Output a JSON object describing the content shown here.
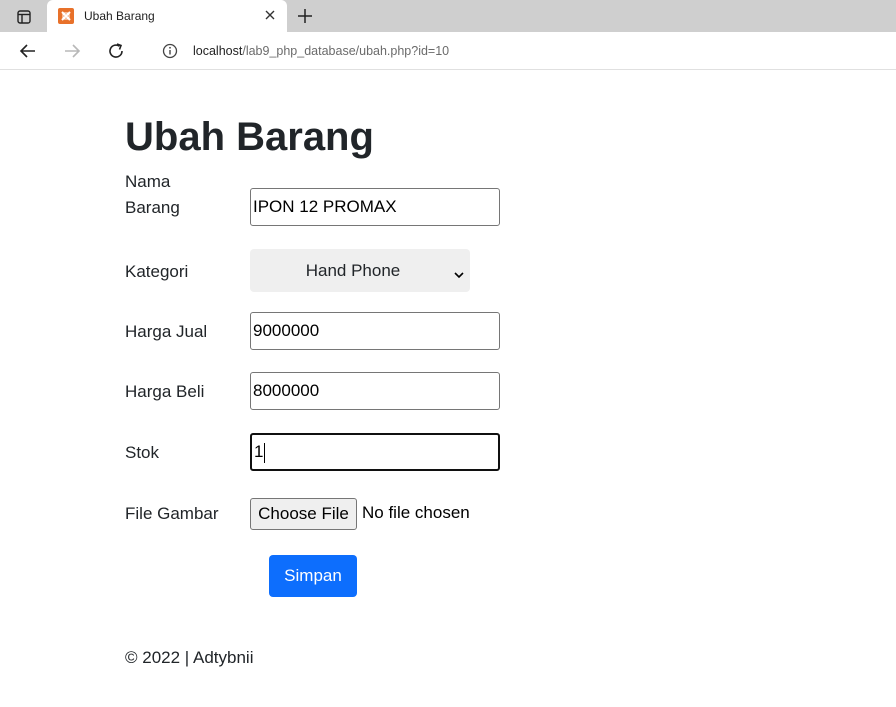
{
  "browser": {
    "tab_title": "Ubah Barang",
    "url_host": "localhost",
    "url_path": "/lab9_php_database/ubah.php?id=10",
    "icons": {
      "tab_actions": "sidebar-panel-icon",
      "favicon": "xampp-icon",
      "close": "close-icon",
      "new_tab": "plus-icon",
      "back": "arrow-left-icon",
      "forward": "arrow-right-icon",
      "refresh": "refresh-icon",
      "info": "info-icon"
    }
  },
  "page": {
    "title": "Ubah Barang"
  },
  "form": {
    "nama_label": "Nama Barang",
    "nama_value": "IPON 12 PROMAX",
    "kategori_label": "Kategori",
    "kategori_value": "Hand Phone",
    "harga_jual_label": "Harga Jual",
    "harga_jual_value": "9000000",
    "harga_beli_label": "Harga Beli",
    "harga_beli_value": "8000000",
    "stok_label": "Stok",
    "stok_value": "1",
    "gambar_label": "File Gambar",
    "file_button_label": "Choose File",
    "file_status": "No file chosen",
    "submit_label": "Simpan"
  },
  "footer": {
    "text": "© 2022 | Adtybnii"
  },
  "colors": {
    "primary": "#0d6efd",
    "text": "#212529",
    "favicon": "#e8712a"
  }
}
